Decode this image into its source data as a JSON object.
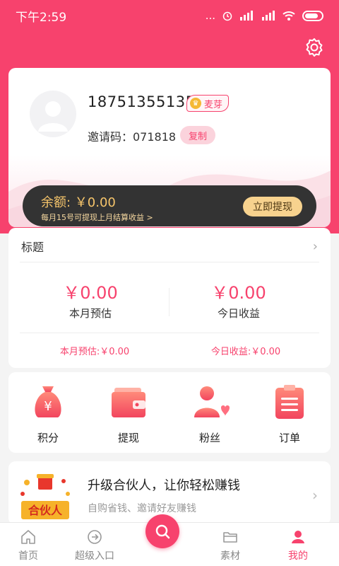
{
  "status_bar": {
    "time": "下午2:59",
    "signal": "...",
    "network": "4G"
  },
  "colors": {
    "accent": "#f7426d",
    "balance_bg": "#333333",
    "gold": "#f6c56b"
  },
  "profile": {
    "phone": "18751355135",
    "level_badge": "麦芽",
    "invite_label": "邀请码：071818",
    "copy_label": "复制",
    "avatar_icon": "user-icon"
  },
  "balance": {
    "label": "余额: ￥0.00",
    "note": "每月15号可提现上月结算收益 >",
    "withdraw_label": "立即提现"
  },
  "stats": {
    "title": "标题",
    "month_amount": "￥0.00",
    "month_label": "本月预估",
    "today_amount": "￥0.00",
    "today_label": "今日收益",
    "month_sub": "本月预估:￥0.00",
    "today_sub": "今日收益:￥0.00"
  },
  "grid": [
    {
      "label": "积分",
      "icon": "money-bag-icon"
    },
    {
      "label": "提现",
      "icon": "wallet-icon"
    },
    {
      "label": "粉丝",
      "icon": "fans-icon"
    },
    {
      "label": "订单",
      "icon": "order-icon"
    }
  ],
  "partner": {
    "title": "升级合伙人，让你轻松赚钱",
    "subtitle": "自购省钱、邀请好友赚钱",
    "image_text": "合伙人"
  },
  "tabs": [
    {
      "label": "首页",
      "icon": "home-icon",
      "active": false
    },
    {
      "label": "超级入口",
      "icon": "enter-icon",
      "active": false
    },
    {
      "label": "",
      "icon": "search-icon",
      "active": false
    },
    {
      "label": "素材",
      "icon": "folder-icon",
      "active": false
    },
    {
      "label": "我的",
      "icon": "profile-icon",
      "active": true
    }
  ]
}
